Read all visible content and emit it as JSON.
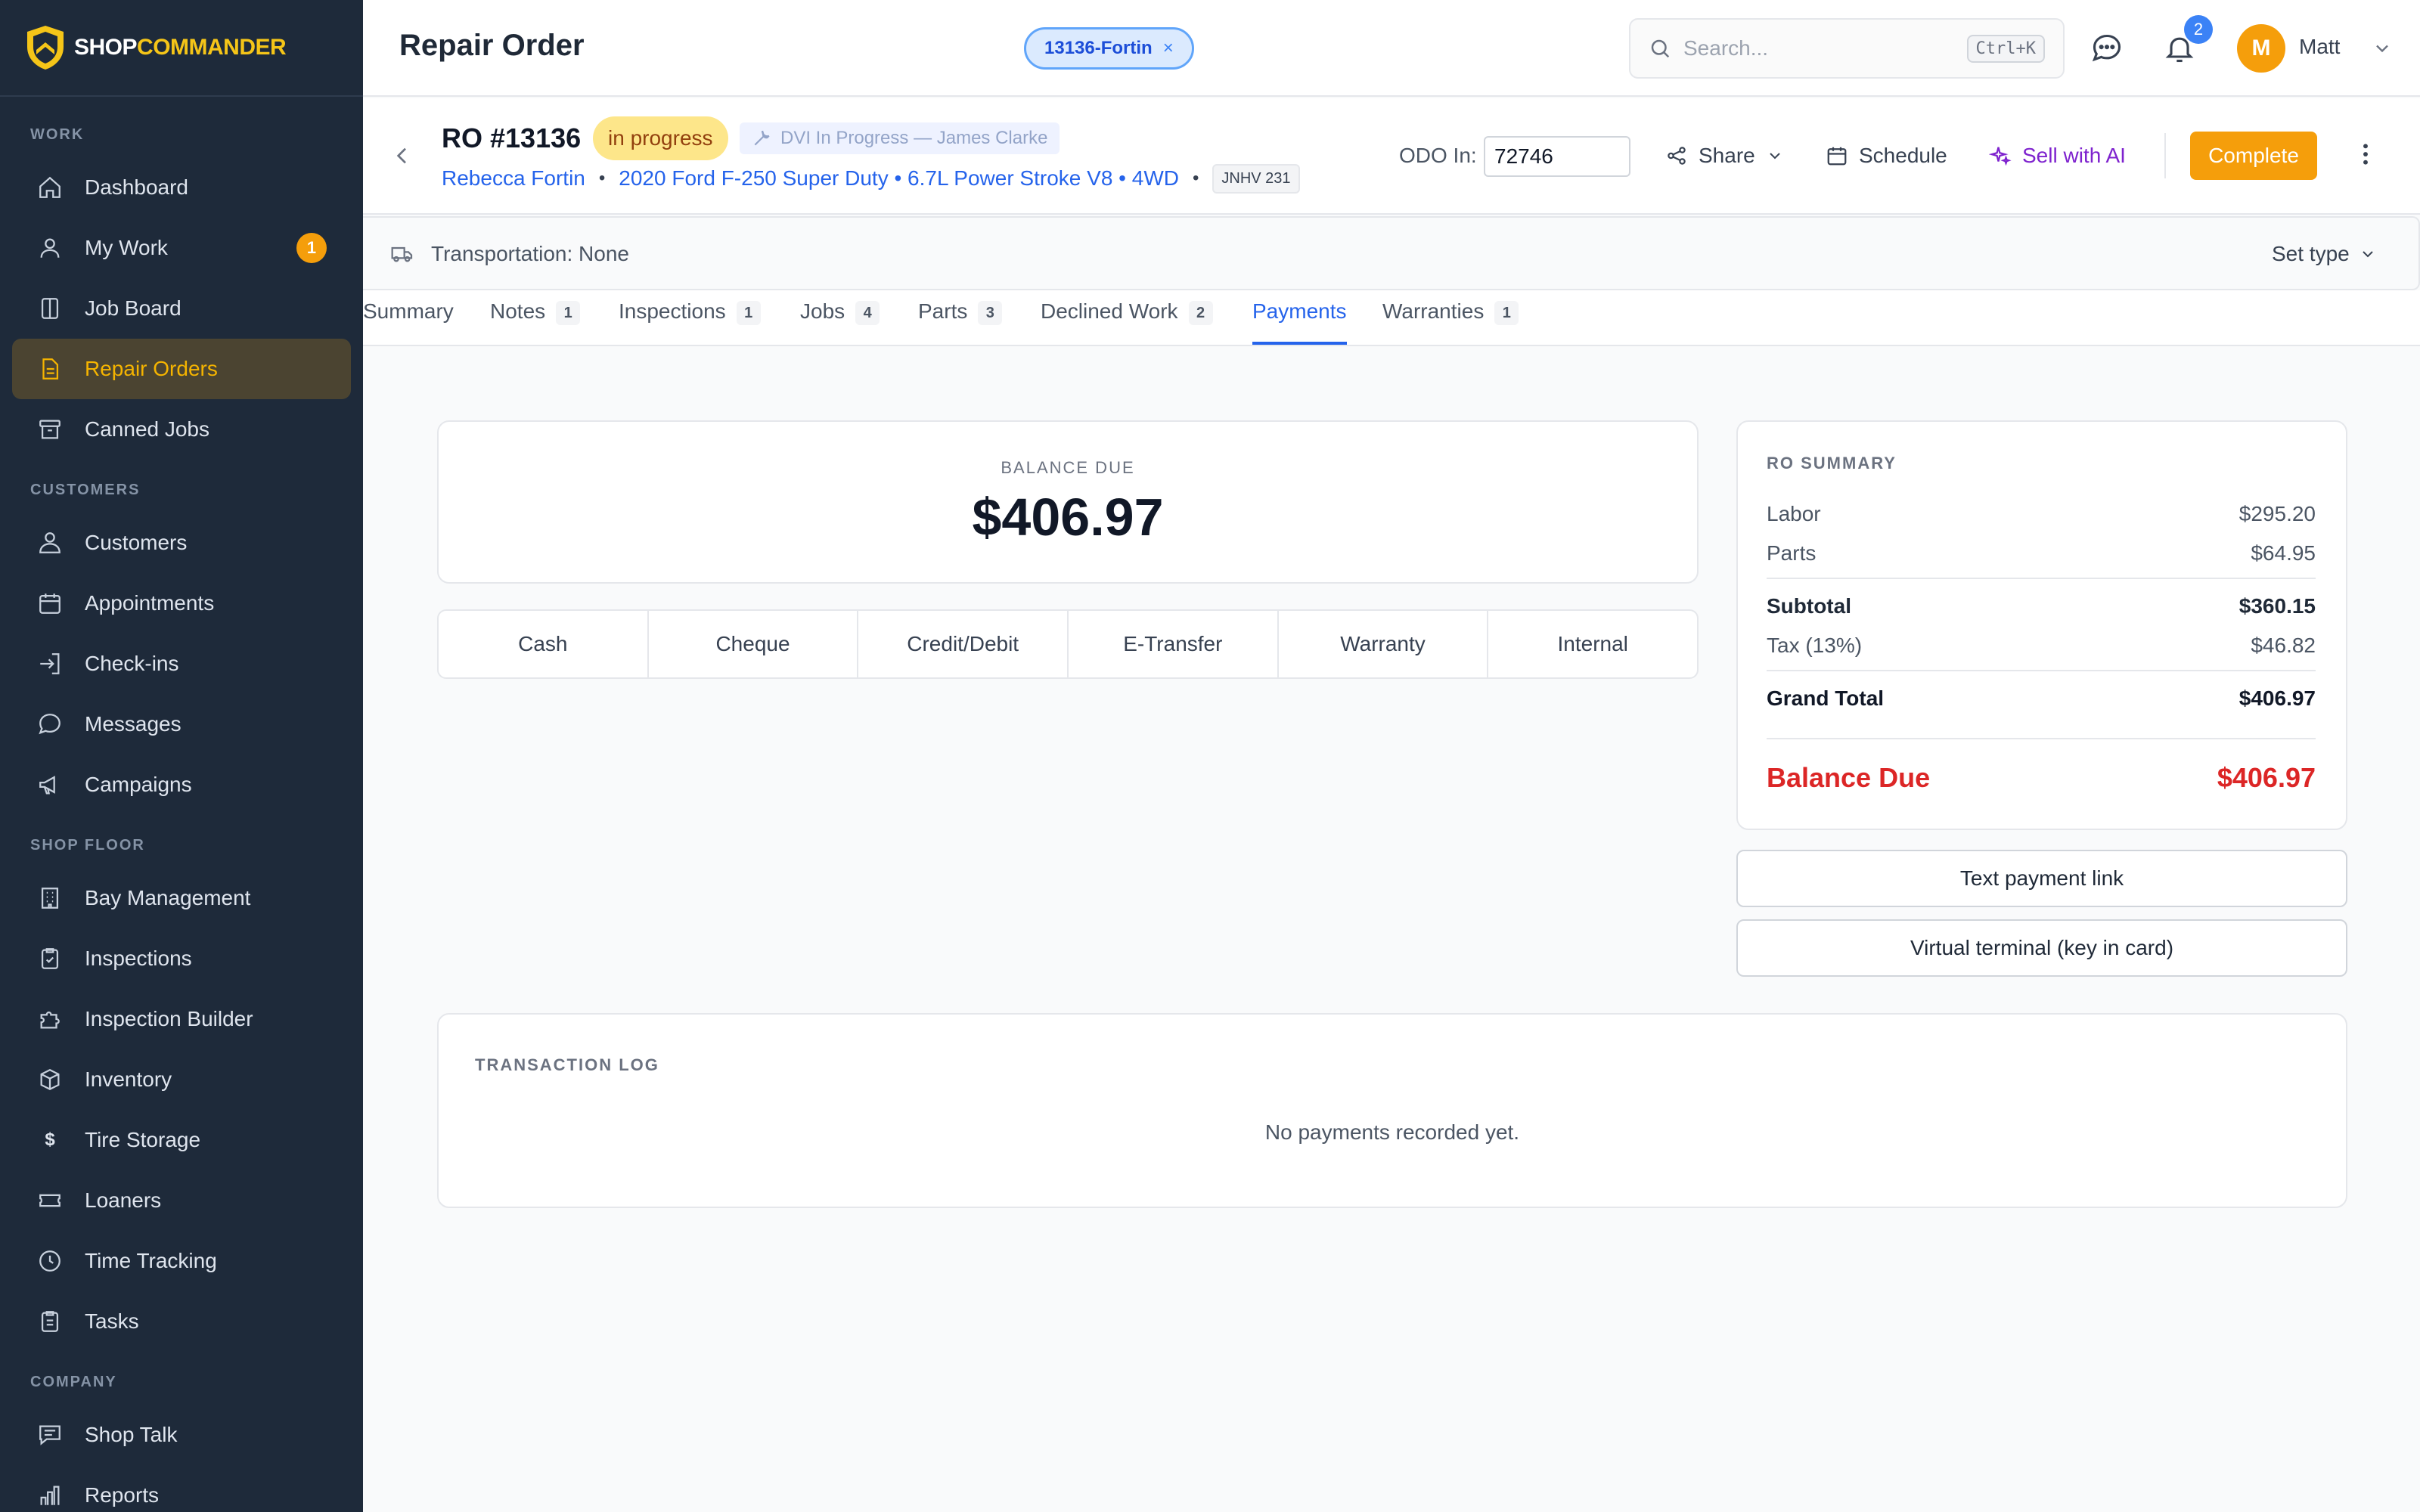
{
  "brand": {
    "part1": "SHOP",
    "part2": "COMMANDER"
  },
  "sidebar": {
    "sections": [
      {
        "label": "WORK",
        "items": [
          {
            "label": "Dashboard",
            "icon": "home-icon"
          },
          {
            "label": "My Work",
            "icon": "user-icon",
            "badge": "1"
          },
          {
            "label": "Job Board",
            "icon": "columns-icon"
          },
          {
            "label": "Repair Orders",
            "icon": "document-icon",
            "active": true
          },
          {
            "label": "Canned Jobs",
            "icon": "archive-icon"
          }
        ]
      },
      {
        "label": "CUSTOMERS",
        "items": [
          {
            "label": "Customers",
            "icon": "person-icon"
          },
          {
            "label": "Appointments",
            "icon": "calendar-icon"
          },
          {
            "label": "Check-ins",
            "icon": "login-icon"
          },
          {
            "label": "Messages",
            "icon": "chat-icon"
          },
          {
            "label": "Campaigns",
            "icon": "megaphone-icon"
          }
        ]
      },
      {
        "label": "SHOP FLOOR",
        "items": [
          {
            "label": "Bay Management",
            "icon": "building-icon"
          },
          {
            "label": "Inspections",
            "icon": "clipboard-check-icon"
          },
          {
            "label": "Inspection Builder",
            "icon": "puzzle-icon"
          },
          {
            "label": "Inventory",
            "icon": "cube-icon"
          },
          {
            "label": "Tire Storage",
            "icon": "dollar-icon"
          },
          {
            "label": "Loaners",
            "icon": "ticket-icon"
          },
          {
            "label": "Time Tracking",
            "icon": "clock-icon"
          },
          {
            "label": "Tasks",
            "icon": "clipboard-icon"
          }
        ]
      },
      {
        "label": "COMPANY",
        "items": [
          {
            "label": "Shop Talk",
            "icon": "message-square-icon"
          },
          {
            "label": "Reports",
            "icon": "bar-chart-icon"
          }
        ]
      }
    ]
  },
  "header": {
    "title": "Repair Order",
    "ro_chip": "13136-Fortin",
    "ro_chip_close": "×",
    "search_placeholder": "Search...",
    "search_shortcut": "Ctrl+K",
    "notifications": "2",
    "user_initial": "M",
    "user_name": "Matt"
  },
  "ro": {
    "number": "RO #13136",
    "status": "in progress",
    "dvi": "DVI In Progress — James Clarke",
    "customer": "Rebecca Fortin",
    "vehicle": "2020 Ford F-250 Super Duty • 6.7L Power Stroke V8 • 4WD",
    "plate": "JNHV 231",
    "odo_label": "ODO In:",
    "odo_value": "72746",
    "share": "Share",
    "schedule": "Schedule",
    "sell_ai": "Sell with AI",
    "complete": "Complete"
  },
  "transport": {
    "label": "Transportation: None",
    "set_type": "Set type"
  },
  "tabs": [
    {
      "label": "Summary",
      "count": ""
    },
    {
      "label": "Notes",
      "count": "1"
    },
    {
      "label": "Inspections",
      "count": "1"
    },
    {
      "label": "Jobs",
      "count": "4"
    },
    {
      "label": "Parts",
      "count": "3"
    },
    {
      "label": "Declined Work",
      "count": "2"
    },
    {
      "label": "Payments",
      "count": "",
      "active": true
    },
    {
      "label": "Warranties",
      "count": "1"
    }
  ],
  "payments": {
    "balance_label": "BALANCE DUE",
    "balance_value": "$406.97",
    "methods": [
      "Cash",
      "Cheque",
      "Credit/Debit",
      "E-Transfer",
      "Warranty",
      "Internal"
    ]
  },
  "summary": {
    "title": "RO SUMMARY",
    "labor_label": "Labor",
    "labor": "$295.20",
    "parts_label": "Parts",
    "parts": "$64.95",
    "subtotal_label": "Subtotal",
    "subtotal": "$360.15",
    "tax_label": "Tax (13%)",
    "tax": "$46.82",
    "grand_label": "Grand Total",
    "grand": "$406.97",
    "due_label": "Balance Due",
    "due": "$406.97"
  },
  "actions": {
    "text_link": "Text payment link",
    "virtual_terminal": "Virtual terminal (key in card)"
  },
  "log": {
    "title": "TRANSACTION LOG",
    "empty": "No payments recorded yet."
  },
  "colors": {
    "accent": "#f59e0b",
    "sidebar": "#1e2a3a",
    "link": "#2563eb",
    "danger": "#dc2626",
    "ai": "#7e22ce"
  }
}
